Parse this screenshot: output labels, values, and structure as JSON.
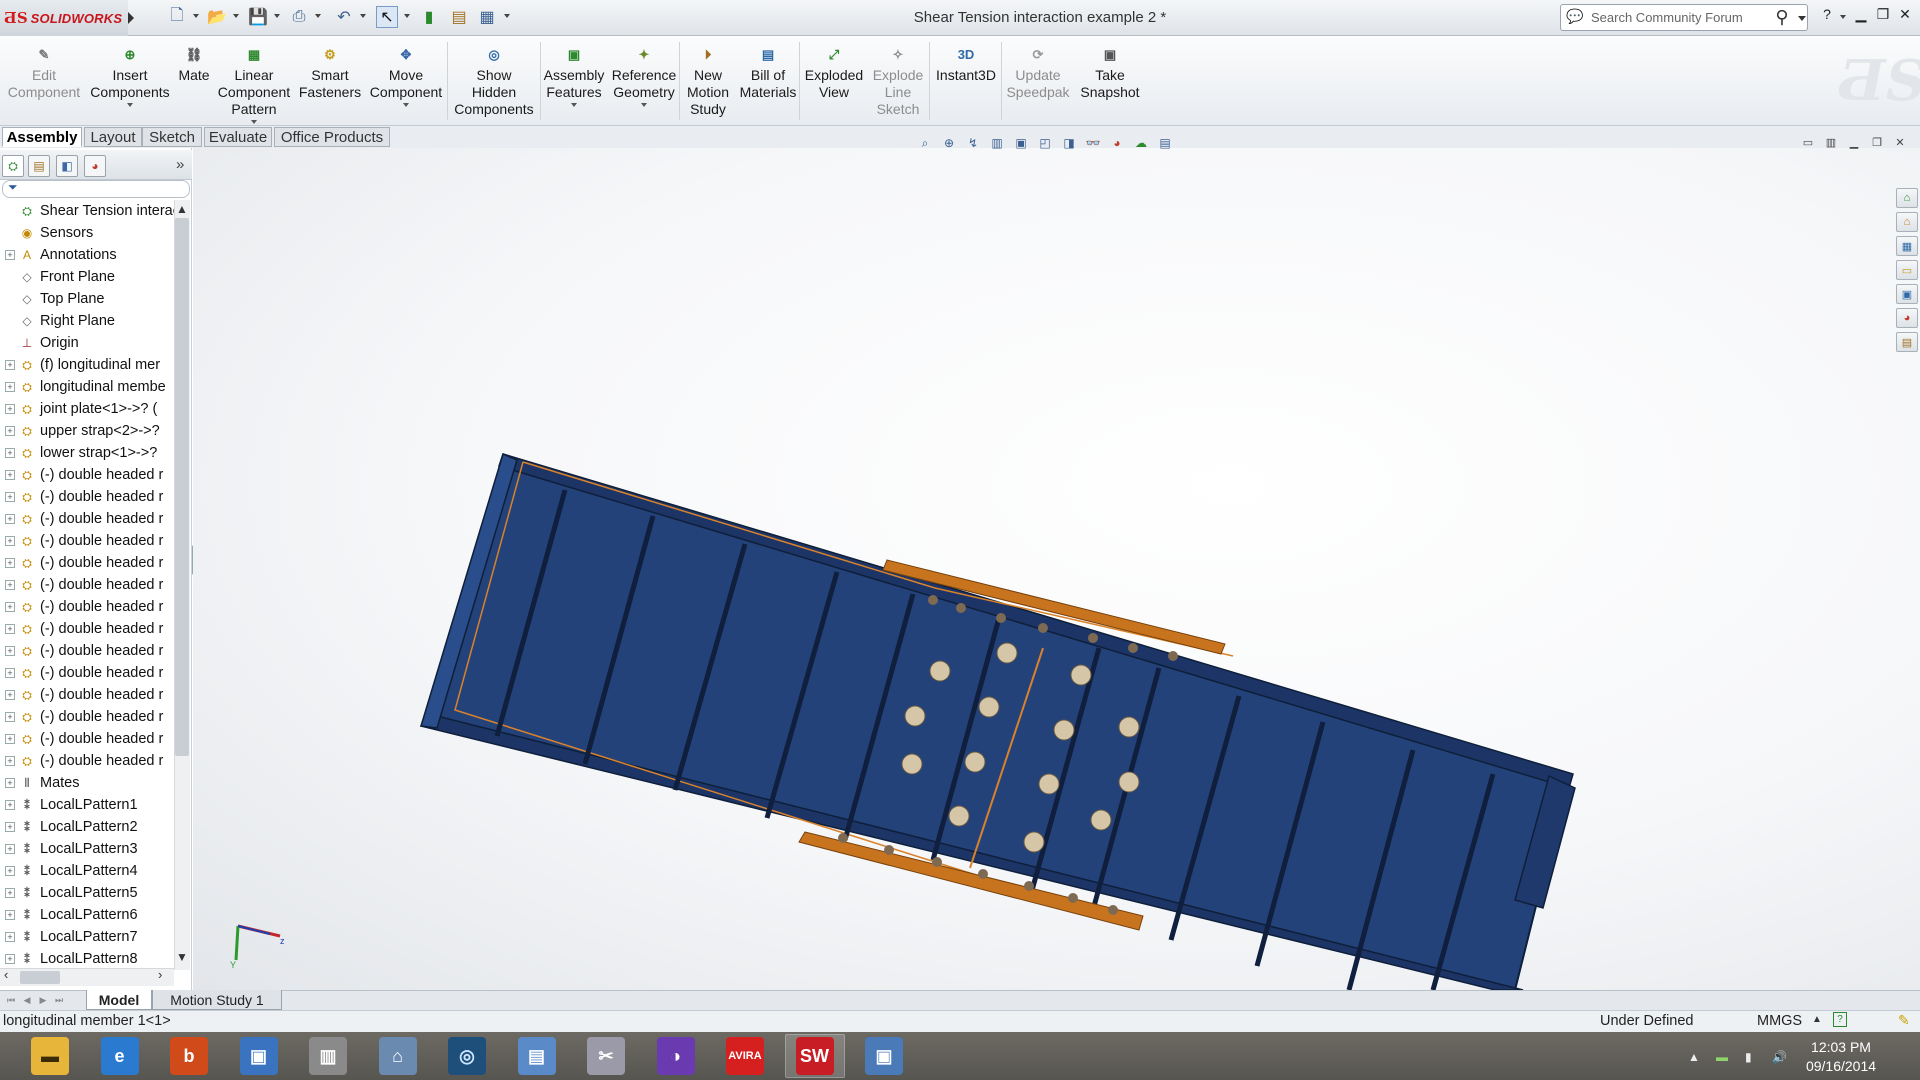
{
  "app": {
    "brand": "SOLIDWORKS",
    "title": "Shear Tension interaction example 2 *"
  },
  "search": {
    "placeholder": "Search Community Forum"
  },
  "ribbon": [
    {
      "label": "Edit\nComponent",
      "icon": "edit-component-icon",
      "disabled": true
    },
    {
      "label": "Insert\nComponents",
      "icon": "insert-components-icon",
      "dropdown": true
    },
    {
      "label": "Mate",
      "icon": "paperclip-icon"
    },
    {
      "label": "Linear\nComponent\nPattern",
      "icon": "linear-pattern-icon",
      "dropdown": true
    },
    {
      "label": "Smart\nFasteners",
      "icon": "smart-fasteners-icon"
    },
    {
      "label": "Move\nComponent",
      "icon": "move-component-icon",
      "dropdown": true
    },
    {
      "label": "Show\nHidden\nComponents",
      "icon": "show-hidden-icon"
    },
    {
      "label": "Assembly\nFeatures",
      "icon": "assembly-features-icon",
      "dropdown": true
    },
    {
      "label": "Reference\nGeometry",
      "icon": "reference-geometry-icon",
      "dropdown": true
    },
    {
      "label": "New\nMotion\nStudy",
      "icon": "motion-study-icon"
    },
    {
      "label": "Bill of\nMaterials",
      "icon": "bill-of-materials-icon"
    },
    {
      "label": "Exploded\nView",
      "icon": "exploded-view-icon"
    },
    {
      "label": "Explode\nLine\nSketch",
      "icon": "explode-line-sketch-icon",
      "disabled": true
    },
    {
      "label": "Instant3D",
      "icon": "instant3d-icon"
    },
    {
      "label": "Update\nSpeedpak",
      "icon": "update-speedpak-icon",
      "disabled": true
    },
    {
      "label": "Take\nSnapshot",
      "icon": "take-snapshot-icon"
    }
  ],
  "command_tabs": [
    "Assembly",
    "Layout",
    "Sketch",
    "Evaluate",
    "Office Products"
  ],
  "active_command_tab": "Assembly",
  "tree": [
    {
      "label": "Shear Tension interacti",
      "icon": "assembly-icon",
      "expand": "none"
    },
    {
      "label": "Sensors",
      "icon": "sensors-icon",
      "expand": "none"
    },
    {
      "label": "Annotations",
      "icon": "annotations-icon",
      "expand": "plus"
    },
    {
      "label": "Front Plane",
      "icon": "plane-icon",
      "expand": "none"
    },
    {
      "label": "Top Plane",
      "icon": "plane-icon",
      "expand": "none"
    },
    {
      "label": "Right Plane",
      "icon": "plane-icon",
      "expand": "none"
    },
    {
      "label": "Origin",
      "icon": "origin-icon",
      "expand": "none"
    },
    {
      "label": "(f) longitudinal mer",
      "icon": "part-icon",
      "expand": "plus"
    },
    {
      "label": "longitudinal membe",
      "icon": "part-icon",
      "expand": "plus"
    },
    {
      "label": "joint plate<1>->? (",
      "icon": "part-icon",
      "expand": "plus"
    },
    {
      "label": "upper strap<2>->?",
      "icon": "part-icon",
      "expand": "plus"
    },
    {
      "label": "lower strap<1>->?",
      "icon": "part-icon",
      "expand": "plus"
    },
    {
      "label": "(-) double headed r",
      "icon": "part-icon",
      "expand": "plus"
    },
    {
      "label": "(-) double headed r",
      "icon": "part-icon",
      "expand": "plus"
    },
    {
      "label": "(-) double headed r",
      "icon": "part-icon",
      "expand": "plus"
    },
    {
      "label": "(-) double headed r",
      "icon": "part-icon",
      "expand": "plus"
    },
    {
      "label": "(-) double headed r",
      "icon": "part-icon",
      "expand": "plus"
    },
    {
      "label": "(-) double headed r",
      "icon": "part-icon",
      "expand": "plus"
    },
    {
      "label": "(-) double headed r",
      "icon": "part-icon",
      "expand": "plus"
    },
    {
      "label": "(-) double headed r",
      "icon": "part-icon",
      "expand": "plus"
    },
    {
      "label": "(-) double headed r",
      "icon": "part-icon",
      "expand": "plus"
    },
    {
      "label": "(-) double headed r",
      "icon": "part-icon",
      "expand": "plus"
    },
    {
      "label": "(-) double headed r",
      "icon": "part-icon",
      "expand": "plus"
    },
    {
      "label": "(-) double headed r",
      "icon": "part-icon",
      "expand": "plus"
    },
    {
      "label": "(-) double headed r",
      "icon": "part-icon",
      "expand": "plus"
    },
    {
      "label": "(-) double headed r",
      "icon": "part-icon",
      "expand": "plus"
    },
    {
      "label": "Mates",
      "icon": "mates-icon",
      "expand": "plus"
    },
    {
      "label": "LocalLPattern1",
      "icon": "pattern-icon",
      "expand": "plus"
    },
    {
      "label": "LocalLPattern2",
      "icon": "pattern-icon",
      "expand": "plus"
    },
    {
      "label": "LocalLPattern3",
      "icon": "pattern-icon",
      "expand": "plus"
    },
    {
      "label": "LocalLPattern4",
      "icon": "pattern-icon",
      "expand": "plus"
    },
    {
      "label": "LocalLPattern5",
      "icon": "pattern-icon",
      "expand": "plus"
    },
    {
      "label": "LocalLPattern6",
      "icon": "pattern-icon",
      "expand": "plus"
    },
    {
      "label": "LocalLPattern7",
      "icon": "pattern-icon",
      "expand": "plus"
    },
    {
      "label": "LocalLPattern8",
      "icon": "pattern-icon",
      "expand": "plus"
    }
  ],
  "bottom_tabs": [
    "Model",
    "Motion Study 1"
  ],
  "status": {
    "selection": "longitudinal member 1<1>",
    "state": "Under Defined",
    "units": "MMGS"
  },
  "clock": {
    "time": "12:03 PM",
    "date": "09/16/2014"
  },
  "colors": {
    "beam": "#24427a",
    "strap": "#c8741e",
    "bolt": "#d6c6a8",
    "title_red": "#c8151b"
  },
  "taskbar": [
    {
      "name": "file-explorer-icon"
    },
    {
      "name": "internet-explorer-icon"
    },
    {
      "name": "bing-icon"
    },
    {
      "name": "remote-desktop-icon"
    },
    {
      "name": "city-icon"
    },
    {
      "name": "network-icon"
    },
    {
      "name": "disc-burner-icon"
    },
    {
      "name": "file-manager-icon"
    },
    {
      "name": "tools-icon"
    },
    {
      "name": "media-player-icon"
    },
    {
      "name": "avira-icon",
      "label": "AVIRA"
    },
    {
      "name": "solidworks-taskbar-icon",
      "label": "SW",
      "running": true
    },
    {
      "name": "virtualbox-icon"
    }
  ]
}
